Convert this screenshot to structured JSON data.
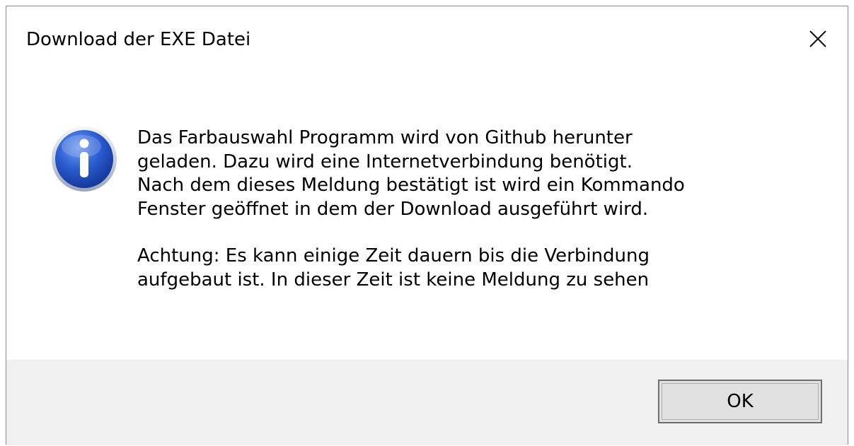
{
  "dialog": {
    "title": "Download der EXE Datei",
    "close_icon": "close-icon",
    "message_icon": "info-icon",
    "message_paragraphs": [
      "Das Farbauswahl Programm wird von Github herunter\ngeladen. Dazu wird eine Internetverbindung benötigt.\nNach dem dieses Meldung bestätigt ist wird ein Kommando\nFenster geöffnet in dem der Download ausgeführt wird.",
      "Achtung: Es kann einige Zeit dauern bis die Verbindung\naufgebaut ist. In dieser Zeit ist keine Meldung zu sehen"
    ],
    "ok_label": "OK"
  },
  "colors": {
    "window_background": "#ffffff",
    "footer_background": "#f0f0f0",
    "button_background": "#e1e1e1",
    "button_border": "#6f6f6f",
    "info_icon_blue": "#1d4fbf"
  }
}
